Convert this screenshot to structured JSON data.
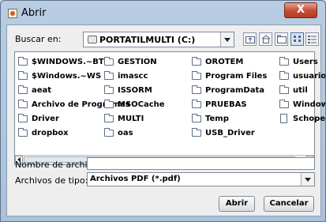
{
  "window": {
    "title": "Abrir",
    "close_label": "X"
  },
  "look_in": {
    "label": "Buscar en:",
    "value": "PORTATILMULTI (C:)"
  },
  "toolbar": {
    "icons": [
      "up-folder-icon",
      "home-icon",
      "new-folder-icon",
      "list-view-icon",
      "details-view-icon"
    ]
  },
  "files": [
    {
      "name": "$WINDOWS.~BT",
      "type": "folder"
    },
    {
      "name": "$Windows.~WS",
      "type": "folder"
    },
    {
      "name": "aeat",
      "type": "folder"
    },
    {
      "name": "Archivo de Programas",
      "type": "folder"
    },
    {
      "name": "Driver",
      "type": "folder"
    },
    {
      "name": "dropbox",
      "type": "folder"
    },
    {
      "name": "GESTION",
      "type": "folder"
    },
    {
      "name": "imascc",
      "type": "folder"
    },
    {
      "name": "ISSORM",
      "type": "folder"
    },
    {
      "name": "MSOCache",
      "type": "folder"
    },
    {
      "name": "MULTI",
      "type": "folder"
    },
    {
      "name": "oas",
      "type": "folder"
    },
    {
      "name": "OROTEM",
      "type": "folder"
    },
    {
      "name": "Program Files",
      "type": "folder"
    },
    {
      "name": "ProgramData",
      "type": "folder"
    },
    {
      "name": "PRUEBAS",
      "type": "folder"
    },
    {
      "name": "Temp",
      "type": "folder"
    },
    {
      "name": "USB_Driver",
      "type": "folder"
    },
    {
      "name": "Users",
      "type": "folder"
    },
    {
      "name": "usuario",
      "type": "folder"
    },
    {
      "name": "util",
      "type": "folder"
    },
    {
      "name": "Window",
      "type": "folder"
    },
    {
      "name": "Schope",
      "type": "file"
    }
  ],
  "filename": {
    "label": "Nombre de archivo:",
    "value": ""
  },
  "filetype": {
    "label": "Archivos de tipo:",
    "value": "Archivos PDF (*.pdf)"
  },
  "buttons": {
    "open": "Abrir",
    "cancel": "Cancelar"
  }
}
